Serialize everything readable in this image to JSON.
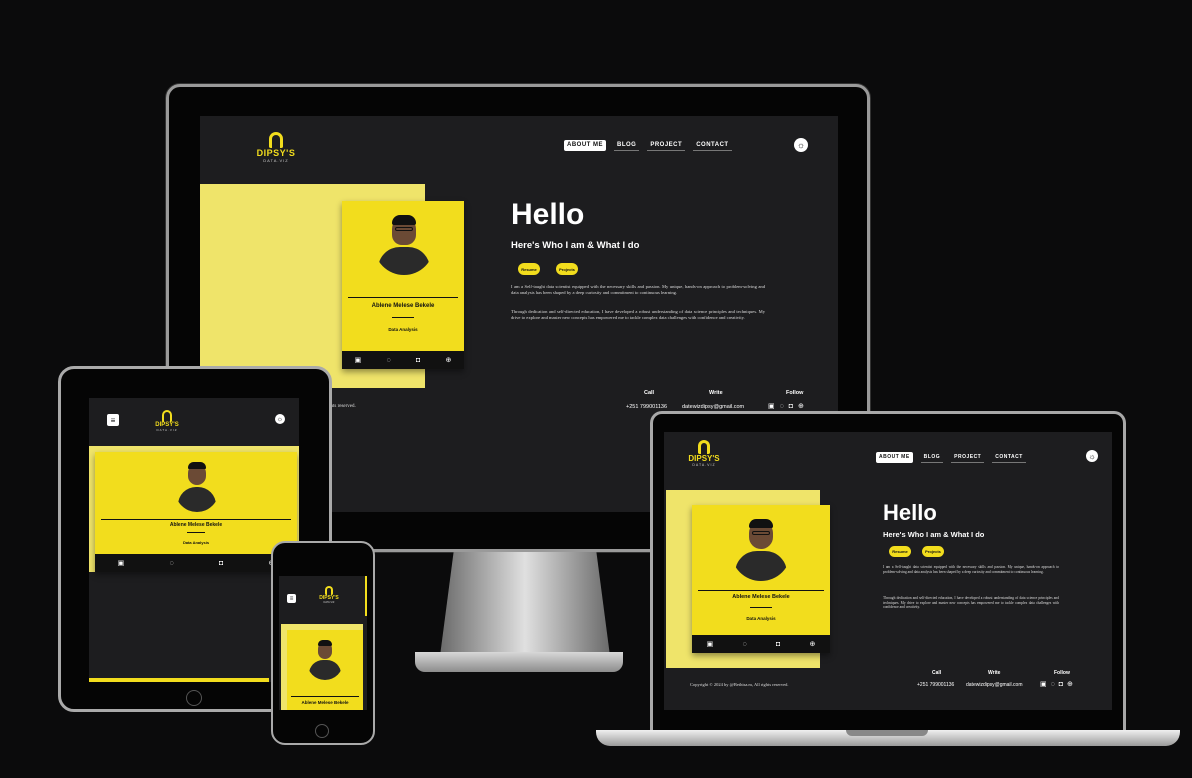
{
  "brand": {
    "name": "DIPSY'S",
    "tagline": "DATA.VIZ"
  },
  "nav": {
    "about": "ABOUT ME",
    "blog": "BLOG",
    "project": "PROJECT",
    "contact": "CONTACT"
  },
  "hero": {
    "title": "Hello",
    "subtitle": "Here's Who I am & What I do",
    "resume_btn": "Resume",
    "projects_btn": "Projects",
    "para1": "I am a Self-taught data scientist equipped with the necessary skills and passion. My unique, hands-on approach to problem-solving and data analysis has been shaped by a deep curiosity and commitment to continuous learning.",
    "para2": "Through dedication and self-directed education, I have developed a robust understanding of data science principles and techniques. My drive to explore and master new concepts has empowered me to tackle complex data challenges with confidence and creativity."
  },
  "profile": {
    "name": "Ablene Melese Bekele",
    "role": "Data Analysis"
  },
  "footer": {
    "copyright": "Copyright © 2024 by @Bethisa.m, All rights reserved.",
    "copyright_partial": "ghts reserved.",
    "call_label": "Call",
    "call_value": "+251 799001136",
    "write_label": "Write",
    "write_value": "datewizdipsy@gmail.com",
    "follow_label": "Follow"
  },
  "icons": [
    "linkedin-icon",
    "whatsapp-icon",
    "instagram-icon",
    "globe-icon",
    "sun-icon",
    "menu-icon"
  ],
  "colors": {
    "accent": "#f2dd1d",
    "accent_light": "#efe46a",
    "background": "#1d1d1f"
  }
}
